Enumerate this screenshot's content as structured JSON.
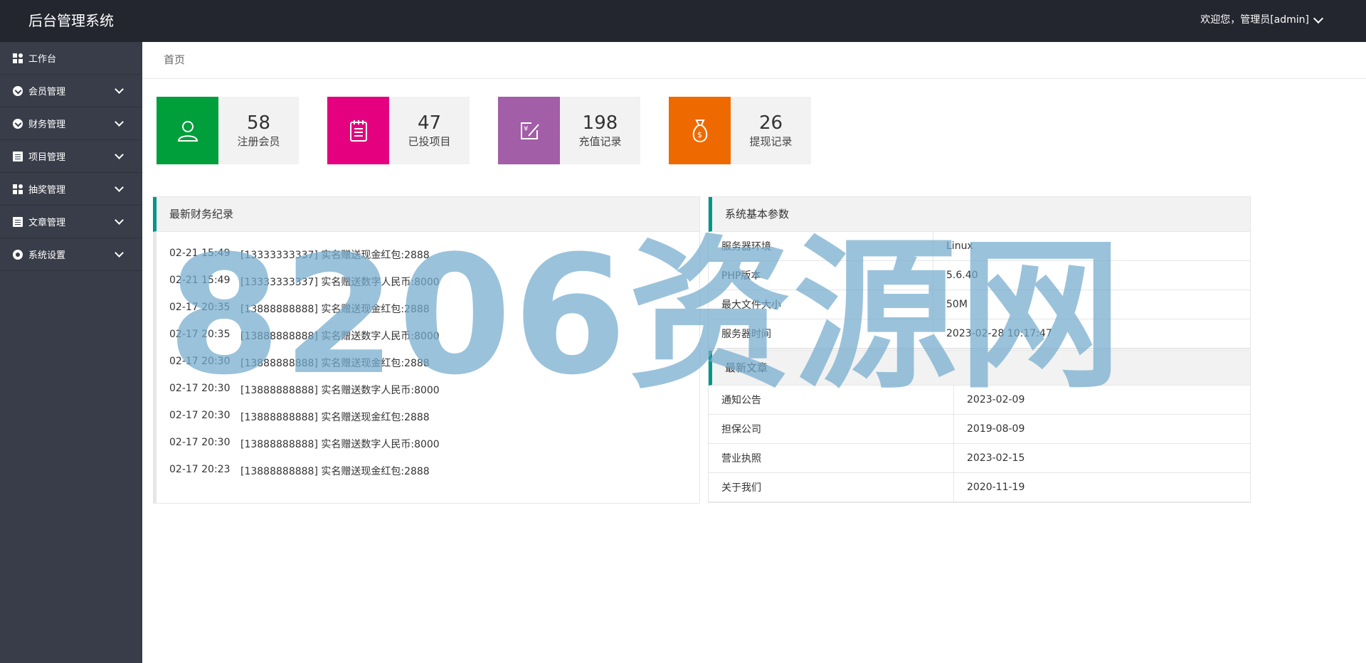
{
  "header": {
    "brand": "后台管理系统",
    "user_text": "欢迎您，管理员[admin]"
  },
  "sidebar": {
    "items": [
      {
        "label": "工作台",
        "icon": "dashboard-icon"
      },
      {
        "label": "会员管理",
        "icon": "member-icon"
      },
      {
        "label": "财务管理",
        "icon": "finance-icon"
      },
      {
        "label": "项目管理",
        "icon": "project-icon"
      },
      {
        "label": "抽奖管理",
        "icon": "lottery-icon"
      },
      {
        "label": "文章管理",
        "icon": "article-icon"
      },
      {
        "label": "系统设置",
        "icon": "settings-icon"
      }
    ]
  },
  "breadcrumb": "首页",
  "stats": [
    {
      "value": "58",
      "label": "注册会员",
      "color": "#009f3c",
      "icon": "user-icon"
    },
    {
      "value": "47",
      "label": "已投项目",
      "color": "#e4007f",
      "icon": "notepad-icon"
    },
    {
      "value": "198",
      "label": "充值记录",
      "color": "#a25ea6",
      "icon": "recharge-icon"
    },
    {
      "value": "26",
      "label": "提现记录",
      "color": "#ee6a00",
      "icon": "money-bag-icon"
    }
  ],
  "finance": {
    "title": "最新财务纪录",
    "rows": [
      {
        "time": "02-21 15:49",
        "text": "[13333333337] 实名赠送现金红包:2888"
      },
      {
        "time": "02-21 15:49",
        "text": "[13333333337] 实名赠送数字人民币:8000"
      },
      {
        "time": "02-17 20:35",
        "text": "[13888888888] 实名赠送现金红包:2888"
      },
      {
        "time": "02-17 20:35",
        "text": "[13888888888] 实名赠送数字人民币:8000"
      },
      {
        "time": "02-17 20:30",
        "text": "[13888888888] 实名赠送现金红包:2888"
      },
      {
        "time": "02-17 20:30",
        "text": "[13888888888] 实名赠送数字人民币:8000"
      },
      {
        "time": "02-17 20:30",
        "text": "[13888888888] 实名赠送现金红包:2888"
      },
      {
        "time": "02-17 20:30",
        "text": "[13888888888] 实名赠送数字人民币:8000"
      },
      {
        "time": "02-17 20:23",
        "text": "[13888888888] 实名赠送现金红包:2888"
      }
    ]
  },
  "system": {
    "title": "系统基本参数",
    "rows": [
      {
        "key": "服务器环境",
        "value": "Linux"
      },
      {
        "key": "PHP版本",
        "value": "5.6.40"
      },
      {
        "key": "最大文件大小",
        "value": "50M"
      },
      {
        "key": "服务器时间",
        "value": "2023-02-28 10:17:47"
      }
    ]
  },
  "articles": {
    "title": "最新文章",
    "rows": [
      {
        "title": "通知公告",
        "date": "2023-02-09"
      },
      {
        "title": "担保公司",
        "date": "2019-08-09"
      },
      {
        "title": "营业执照",
        "date": "2023-02-15"
      },
      {
        "title": "关于我们",
        "date": "2020-11-19"
      }
    ]
  },
  "watermark": "8206资源网"
}
